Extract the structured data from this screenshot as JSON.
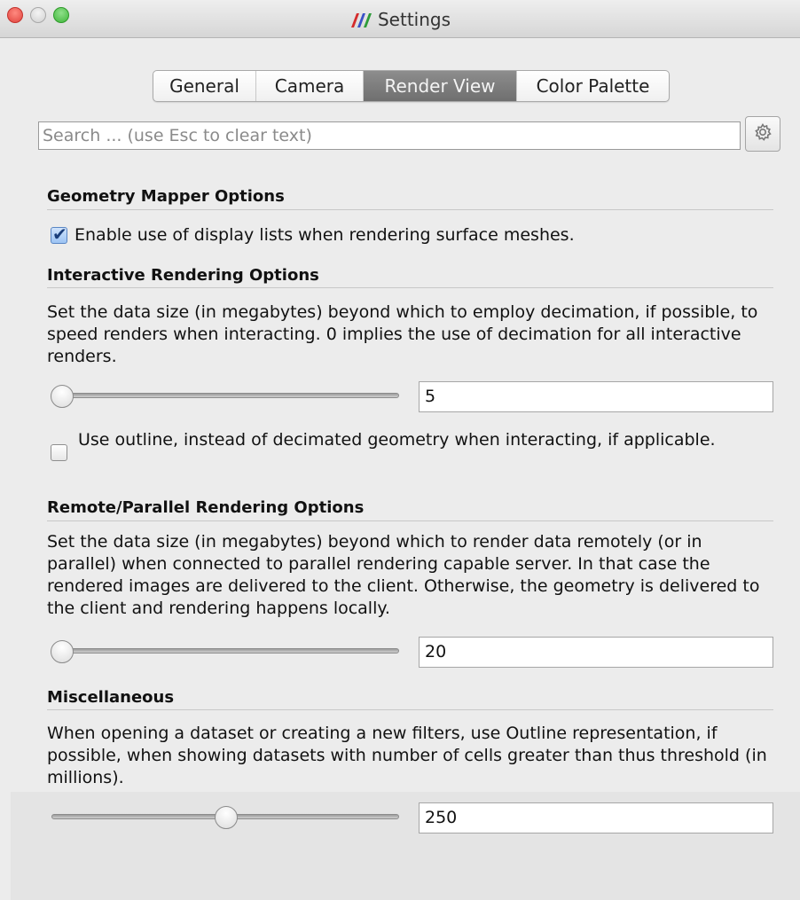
{
  "window": {
    "title": "Settings",
    "logo_icon": "paraview-logo-icon"
  },
  "tabs": [
    {
      "label": "General",
      "active": false
    },
    {
      "label": "Camera",
      "active": false
    },
    {
      "label": "Render View",
      "active": true
    },
    {
      "label": "Color Palette",
      "active": false
    }
  ],
  "search": {
    "placeholder": "Search ... (use Esc to clear text)",
    "value": "",
    "advanced_icon": "gear-icon"
  },
  "sections": {
    "geometry": {
      "heading": "Geometry Mapper Options",
      "checkbox_label": "Enable use of display lists when rendering surface meshes.",
      "checked": true
    },
    "interactive": {
      "heading": "Interactive Rendering Options",
      "description": "Set the data size (in megabytes) beyond which to employ decimation, if possible, to speed renders when interacting. 0 implies the use of decimation for all interactive renders.",
      "value": "5",
      "slider_fraction": 0.0,
      "outline_label": "Use outline, instead of decimated geometry when interacting, if applicable.",
      "outline_checked": false
    },
    "remote": {
      "heading": "Remote/Parallel Rendering Options",
      "description": "Set the data size (in megabytes) beyond which to render data remotely (or in parallel) when connected to parallel rendering capable server. In that case the rendered images are delivered to the client. Otherwise, the geometry is delivered to the client and rendering happens locally.",
      "value": "20",
      "slider_fraction": 0.0
    },
    "misc": {
      "heading": "Miscellaneous",
      "description": "When opening a dataset or creating a new filters, use Outline representation, if possible, when showing datasets with number of cells greater than thus threshold (in millions).",
      "value": "250",
      "slider_fraction": 0.5
    }
  },
  "colors": {
    "active_tab": "#7d7d7d",
    "checkbox_checked": "#9cc4f4",
    "close_button": "#e0443e",
    "maximize_button": "#3fb63a"
  }
}
